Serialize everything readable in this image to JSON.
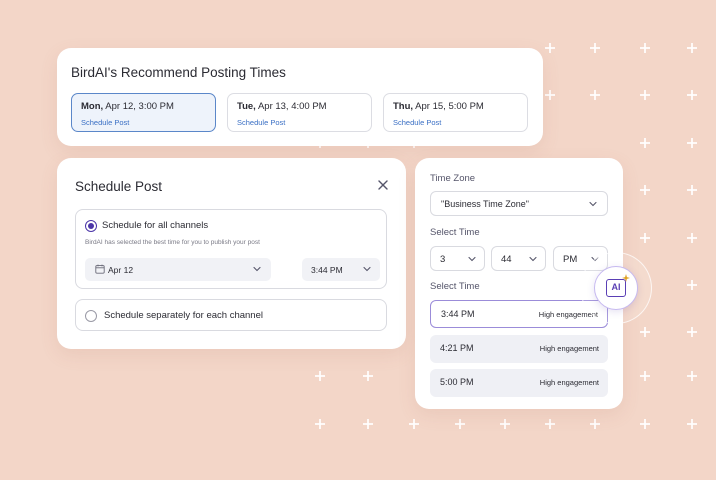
{
  "recommend": {
    "title": "BirdAI's Recommend Posting Times",
    "slots": [
      {
        "day": "Mon,",
        "date": " Apr 12, 3:00 PM",
        "link": "Schedule Post"
      },
      {
        "day": "Tue,",
        "date": " Apr 13, 4:00 PM",
        "link": "Schedule Post"
      },
      {
        "day": "Thu,",
        "date": " Apr 15, 5:00 PM",
        "link": "Schedule Post"
      }
    ]
  },
  "schedule": {
    "title": "Schedule Post",
    "option_all": {
      "label": "Schedule for all channels",
      "sub": "BirdAI has selected the best time for you to publish your post",
      "date": "Apr 12",
      "time": "3:44 PM"
    },
    "option_separate": {
      "label": "Schedule separately for each channel"
    }
  },
  "timezone": {
    "tz_label": "Time Zone",
    "tz_value": "\"Business Time Zone\"",
    "select_time_label": "Select Time",
    "hour": "3",
    "minute": "44",
    "ampm": "PM",
    "select_time_label_2": "Select Time",
    "times": [
      {
        "time": "3:44 PM",
        "engagement": "High engagement"
      },
      {
        "time": "4:21 PM",
        "engagement": "High engagement"
      },
      {
        "time": "5:00 PM",
        "engagement": "High engagement"
      }
    ]
  },
  "ai_badge": {
    "text": "AI"
  },
  "colors": {
    "background": "#f3d6c8",
    "accent": "#4b35a8",
    "link": "#3a6fc4",
    "selected_border": "#5b87c9"
  },
  "icons": [
    "close-icon",
    "calendar-icon",
    "chevron-down-icon",
    "sparkle-icon"
  ]
}
